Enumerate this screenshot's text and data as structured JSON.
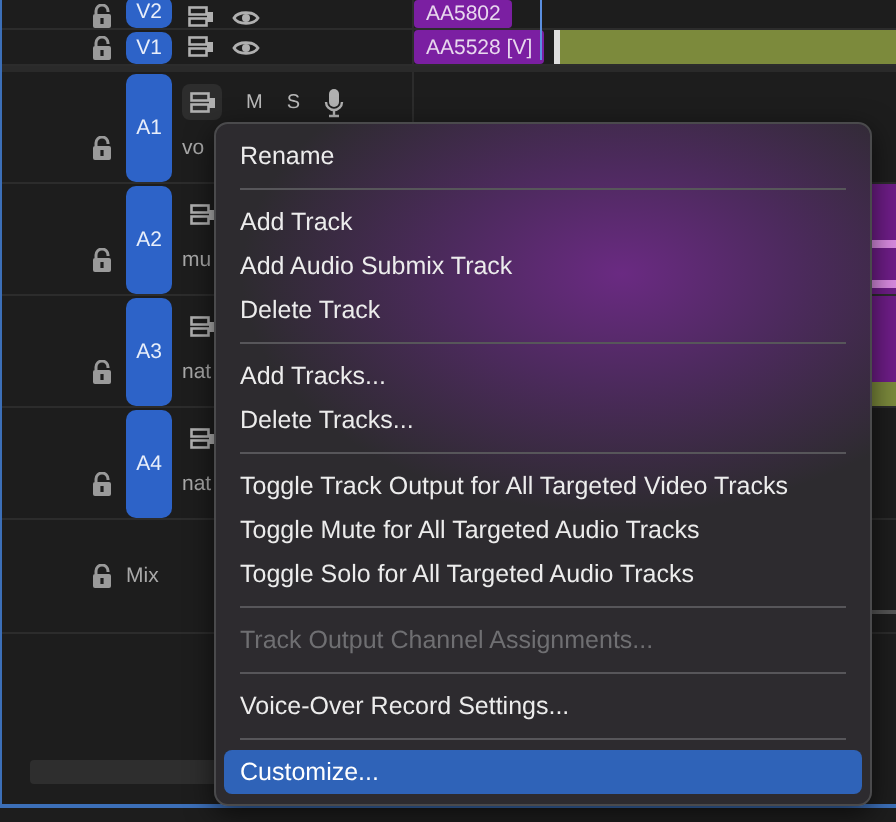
{
  "video_tracks": [
    {
      "label": "V2",
      "clip": "AA5802"
    },
    {
      "label": "V1",
      "clip": "AA5528 [V]"
    }
  ],
  "audio_tracks": [
    {
      "label": "A1",
      "name": "vo",
      "mute": "M",
      "solo": "S"
    },
    {
      "label": "A2",
      "name": "mu",
      "clips": [
        {
          "color": "#6e1d87",
          "kind": "waveform"
        }
      ]
    },
    {
      "label": "A3",
      "name": "nat",
      "clips": [
        {
          "color": "#6e1d87",
          "kind": "plain"
        },
        {
          "color": "#7c8a3c",
          "kind": "strip"
        }
      ]
    },
    {
      "label": "A4",
      "name": "nat"
    }
  ],
  "mix": {
    "label": "Mix"
  },
  "context_menu": [
    {
      "kind": "item",
      "label": "Rename",
      "disabled": false,
      "selected": false
    },
    {
      "kind": "separator"
    },
    {
      "kind": "item",
      "label": "Add Track",
      "disabled": false,
      "selected": false
    },
    {
      "kind": "item",
      "label": "Add Audio Submix Track",
      "disabled": false,
      "selected": false
    },
    {
      "kind": "item",
      "label": "Delete Track",
      "disabled": false,
      "selected": false
    },
    {
      "kind": "separator"
    },
    {
      "kind": "item",
      "label": "Add Tracks...",
      "disabled": false,
      "selected": false
    },
    {
      "kind": "item",
      "label": "Delete Tracks...",
      "disabled": false,
      "selected": false
    },
    {
      "kind": "separator"
    },
    {
      "kind": "item",
      "label": "Toggle Track Output for All Targeted Video Tracks",
      "disabled": false,
      "selected": false
    },
    {
      "kind": "item",
      "label": "Toggle Mute for All Targeted Audio Tracks",
      "disabled": false,
      "selected": false
    },
    {
      "kind": "item",
      "label": "Toggle Solo for All Targeted Audio Tracks",
      "disabled": false,
      "selected": false
    },
    {
      "kind": "separator"
    },
    {
      "kind": "item",
      "label": "Track Output Channel Assignments...",
      "disabled": true,
      "selected": false
    },
    {
      "kind": "separator"
    },
    {
      "kind": "item",
      "label": "Voice-Over Record Settings...",
      "disabled": false,
      "selected": false
    },
    {
      "kind": "separator"
    },
    {
      "kind": "item",
      "label": "Customize...",
      "disabled": false,
      "selected": true
    }
  ]
}
